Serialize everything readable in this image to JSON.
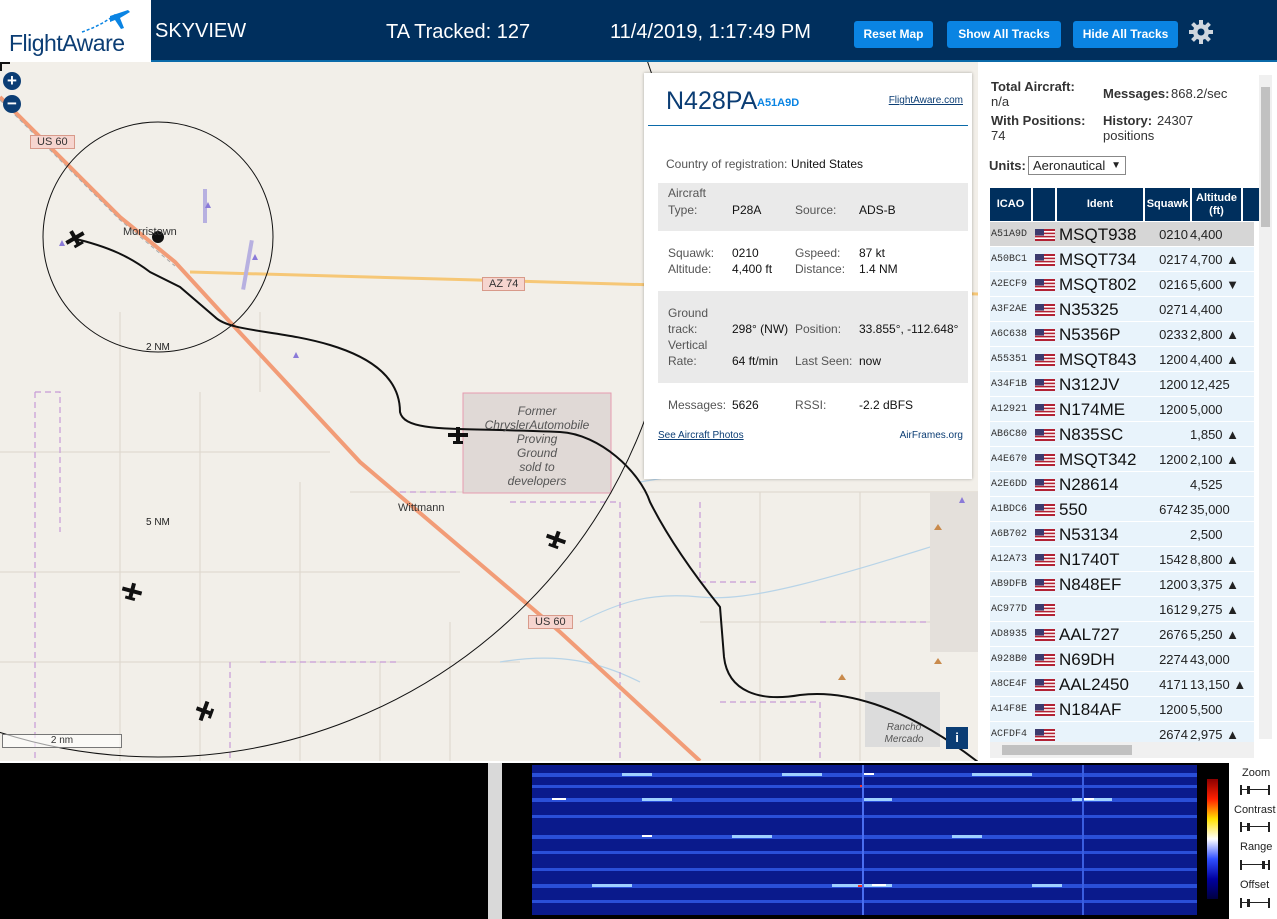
{
  "header": {
    "logo_text": "FlightAware",
    "app_title": "SKYVIEW",
    "tracked": "TA Tracked: 127",
    "datetime": "11/4/2019, 1:17:49 PM",
    "buttons": [
      "Reset Map",
      "Show All Tracks",
      "Hide All Tracks"
    ],
    "settings_icon": "gear-icon"
  },
  "map": {
    "zoom_in": "+",
    "zoom_out": "−",
    "labels": {
      "us60_top": "US 60",
      "us60_bottom": "US 60",
      "az74": "AZ 74",
      "morristown": "Morristown",
      "wittmann": "Wittmann",
      "former": "Former",
      "chrysler": "ChryslerAutomobile",
      "proving": "Proving",
      "ground": "Ground",
      "sold": "sold to",
      "developers": "developers",
      "rancho": "Rancho",
      "mercado": "Mercado",
      "ring_2nm": "2 NM",
      "ring_5nm": "5 NM",
      "scale": "2 nm"
    },
    "info_button": "i"
  },
  "popup": {
    "registration": "N428PA",
    "icao": "A51A9D",
    "flightaware_link": "FlightAware.com",
    "country_label": "Country of registration:",
    "country_value": "United States",
    "aircraft_type_label_1": "Aircraft",
    "aircraft_type_label_2": "Type:",
    "aircraft_type": "P28A",
    "source_label": "Source:",
    "source": "ADS-B",
    "squawk_label": "Squawk:",
    "squawk": "0210",
    "gspeed_label": "Gspeed:",
    "gspeed": "87 kt",
    "altitude_label": "Altitude:",
    "altitude": "4,400 ft",
    "distance_label": "Distance:",
    "distance": "1.4 NM",
    "track_label_1": "Ground",
    "track_label_2": "track:",
    "track": "298° (NW)",
    "position_label": "Position:",
    "position": "33.855°, -112.648°",
    "vrate_label_1": "Vertical",
    "vrate_label_2": "Rate:",
    "vrate": "64 ft/min",
    "lastseen_label": "Last Seen:",
    "lastseen": "now",
    "messages_label": "Messages:",
    "messages": "5626",
    "rssi_label": "RSSI:",
    "rssi": "-2.2 dBFS",
    "photos_link": "See Aircraft Photos",
    "airframes_link": "AirFrames.org"
  },
  "sidebar": {
    "total_label": "Total Aircraft:",
    "total_value": "n/a",
    "messages_label": "Messages:",
    "messages_value": "868.2/sec",
    "withpos_label": "With Positions:",
    "withpos_value": "74",
    "history_label": "History:",
    "history_value_1": "24307",
    "history_value_2": "positions",
    "units_label": "Units:",
    "units_value": "Aeronautical",
    "columns": [
      "ICAO",
      "Ident",
      "Squawk",
      "Altitude (ft)"
    ],
    "rows": [
      {
        "icao": "A51A9D",
        "ident": "MSQT938",
        "squawk": "0210",
        "alt": "4,400"
      },
      {
        "icao": "A50BC1",
        "ident": "MSQT734",
        "squawk": "0217",
        "alt": "4,700 ▲"
      },
      {
        "icao": "A2ECF9",
        "ident": "MSQT802",
        "squawk": "0216",
        "alt": "5,600 ▼"
      },
      {
        "icao": "A3F2AE",
        "ident": "N35325",
        "squawk": "0271",
        "alt": "4,400"
      },
      {
        "icao": "A6C638",
        "ident": "N5356P",
        "squawk": "0233",
        "alt": "2,800 ▲"
      },
      {
        "icao": "A55351",
        "ident": "MSQT843",
        "squawk": "1200",
        "alt": "4,400 ▲"
      },
      {
        "icao": "A34F1B",
        "ident": "N312JV",
        "squawk": "1200",
        "alt": "12,425"
      },
      {
        "icao": "A12921",
        "ident": "N174ME",
        "squawk": "1200",
        "alt": "5,000"
      },
      {
        "icao": "AB6C80",
        "ident": "N835SC",
        "squawk": "",
        "alt": "1,850 ▲"
      },
      {
        "icao": "A4E670",
        "ident": "MSQT342",
        "squawk": "1200",
        "alt": "2,100 ▲"
      },
      {
        "icao": "A2E6DD",
        "ident": "N28614",
        "squawk": "",
        "alt": "4,525"
      },
      {
        "icao": "A1BDC6",
        "ident": "550",
        "squawk": "6742",
        "alt": "35,000"
      },
      {
        "icao": "A6B702",
        "ident": "N53134",
        "squawk": "",
        "alt": "2,500"
      },
      {
        "icao": "A12A73",
        "ident": "N1740T",
        "squawk": "1542",
        "alt": "8,800 ▲"
      },
      {
        "icao": "AB9DFB",
        "ident": "N848EF",
        "squawk": "1200",
        "alt": "3,375 ▲"
      },
      {
        "icao": "AC977D",
        "ident": "",
        "squawk": "1612",
        "alt": "9,275 ▲"
      },
      {
        "icao": "AD8935",
        "ident": "AAL727",
        "squawk": "2676",
        "alt": "5,250 ▲"
      },
      {
        "icao": "A928B0",
        "ident": "N69DH",
        "squawk": "2274",
        "alt": "43,000"
      },
      {
        "icao": "A8CE4F",
        "ident": "AAL2450",
        "squawk": "4171",
        "alt": "13,150 ▲"
      },
      {
        "icao": "A14F8E",
        "ident": "N184AF",
        "squawk": "1200",
        "alt": "5,500"
      },
      {
        "icao": "ACFDF4",
        "ident": "",
        "squawk": "2674",
        "alt": "2,975 ▲"
      }
    ]
  },
  "spectrum": {
    "controls": [
      "Zoom",
      "Contrast",
      "Range",
      "Offset"
    ]
  },
  "colors": {
    "header_bg": "#002f5d",
    "button_bg": "#0a84e3",
    "table_header": "#002f5d",
    "row_bg": "#e8f3fb",
    "selected_row": "#d6d6d6",
    "highway": "#f29c77",
    "az74_road": "#f6c776",
    "track_line": "#000000"
  }
}
